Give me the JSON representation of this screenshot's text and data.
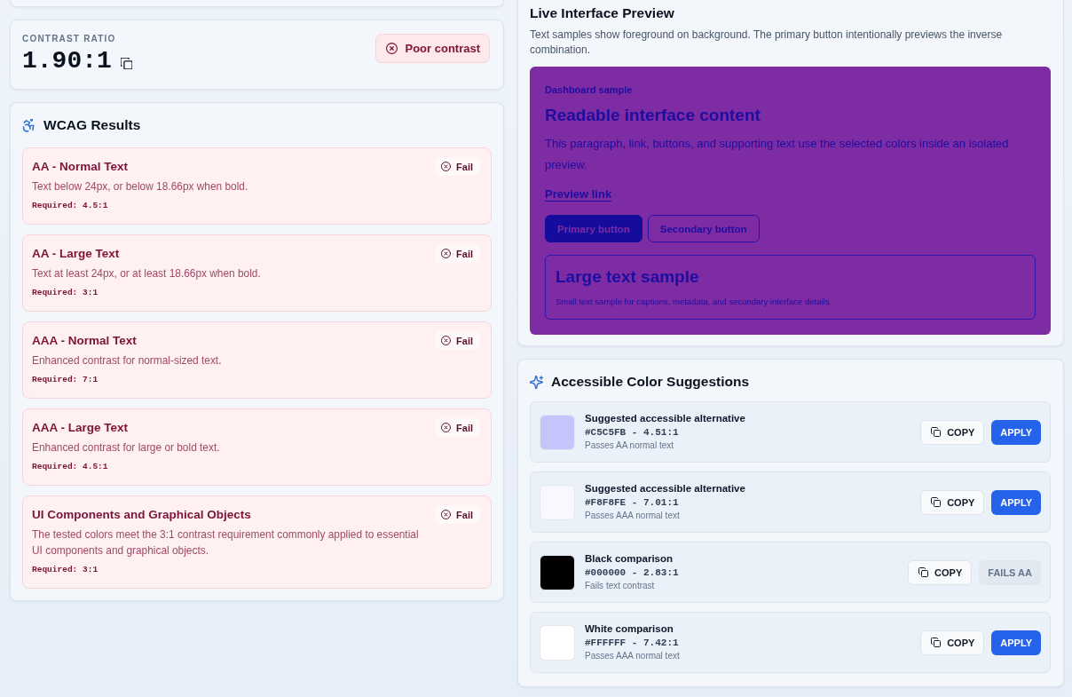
{
  "contrast": {
    "label": "CONTRAST RATIO",
    "ratio": "1.90:1",
    "status": {
      "label": "Poor contrast",
      "kind": "poor"
    }
  },
  "wcag": {
    "title": "WCAG Results",
    "results": [
      {
        "title": "AA - Normal Text",
        "description": "Text below 24px, or below 18.66px when bold.",
        "required": "Required: 4.5:1",
        "verdict": "Fail",
        "passed": false
      },
      {
        "title": "AA - Large Text",
        "description": "Text at least 24px, or at least 18.66px when bold.",
        "required": "Required: 3:1",
        "verdict": "Fail",
        "passed": false
      },
      {
        "title": "AAA - Normal Text",
        "description": "Enhanced contrast for normal-sized text.",
        "required": "Required: 7:1",
        "verdict": "Fail",
        "passed": false
      },
      {
        "title": "AAA - Large Text",
        "description": "Enhanced contrast for large or bold text.",
        "required": "Required: 4.5:1",
        "verdict": "Fail",
        "passed": false
      },
      {
        "title": "UI Components and Graphical Objects",
        "description": "The tested colors meet the 3:1 contrast requirement commonly applied to essential UI components and graphical objects.",
        "required": "Required: 3:1",
        "verdict": "Fail",
        "passed": false
      }
    ]
  },
  "preview": {
    "title": "Live Interface Preview",
    "description": "Text samples show foreground on background. The primary button intentionally previews the inverse combination.",
    "sample": {
      "eyebrow": "Dashboard sample",
      "heading": "Readable interface content",
      "paragraph": "This paragraph, link, buttons, and supporting text use the selected colors inside an isolated preview.",
      "link": "Preview link",
      "buttons": [
        {
          "label": "Primary button",
          "kind": "primary"
        },
        {
          "label": "Secondary button",
          "kind": "secondary"
        }
      ],
      "large_text": "Large text sample",
      "small_text": "Small text sample for captions, metadata, and secondary interface details."
    }
  },
  "suggestions": {
    "title": "Accessible Color Suggestions",
    "items": [
      {
        "title": "Suggested accessible alternative",
        "value": "#C5C5FB - 4.51:1",
        "note": "Passes AA normal text",
        "color": "#c5c5fb",
        "copy_label": "COPY",
        "action": {
          "label": "APPLY",
          "disabled": false
        }
      },
      {
        "title": "Suggested accessible alternative",
        "value": "#F8F8FE - 7.01:1",
        "note": "Passes AAA normal text",
        "color": "#f8f8fe",
        "copy_label": "COPY",
        "action": {
          "label": "APPLY",
          "disabled": false
        }
      },
      {
        "title": "Black comparison",
        "value": "#000000 - 2.83:1",
        "note": "Fails text contrast",
        "color": "#000000",
        "copy_label": "COPY",
        "action": {
          "label": "FAILS AA",
          "disabled": true
        }
      },
      {
        "title": "White comparison",
        "value": "#FFFFFF - 7.42:1",
        "note": "Passes AAA normal text",
        "color": "#ffffff",
        "copy_label": "COPY",
        "action": {
          "label": "APPLY",
          "disabled": false
        }
      }
    ]
  }
}
